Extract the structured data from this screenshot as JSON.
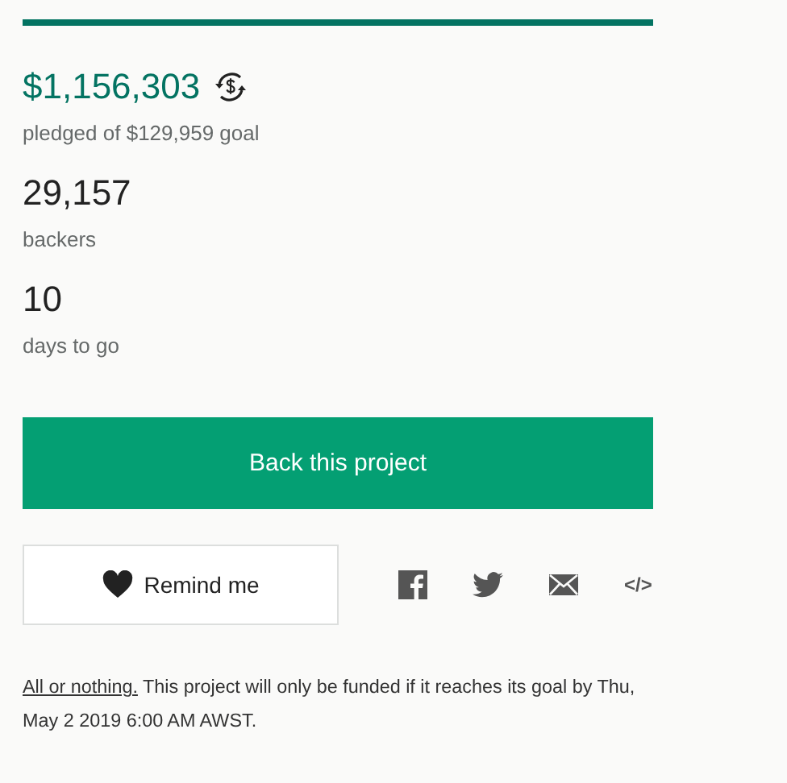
{
  "funding_progress": {
    "level": 1
  },
  "pledged": {
    "amount": "$1,156,303",
    "caption": "pledged of $129,959 goal"
  },
  "stats": [
    {
      "value": "29,157",
      "caption": "backers"
    },
    {
      "value": "10",
      "caption": "days to go"
    }
  ],
  "back_button": "Back this project",
  "remind_button": "Remind me",
  "share": [
    {
      "kind": "facebook"
    },
    {
      "kind": "twitter"
    },
    {
      "kind": "email"
    },
    {
      "kind": "embed",
      "label": "</>"
    }
  ],
  "footer": {
    "link": "All or nothing.",
    "text": "This project will only be funded if it reaches its goal by Thu, May 2 2019 6:00 AM AWST."
  }
}
